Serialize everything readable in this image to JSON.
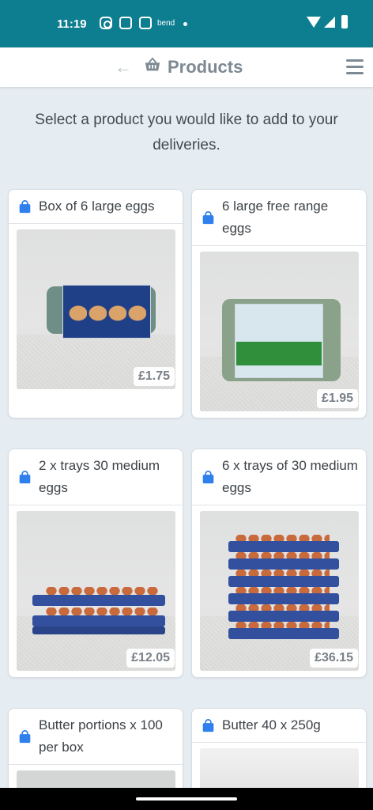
{
  "status_bar": {
    "time": "11:19",
    "notification_icons": [
      "instagram-icon",
      "outlook-icon",
      "outlook-icon"
    ],
    "notification_text": "bend",
    "system_icons": [
      "wifi-icon",
      "signal-icon",
      "battery-icon"
    ]
  },
  "app_bar": {
    "title": "Products",
    "icons": [
      "back-arrow-icon",
      "basket-icon",
      "hamburger-menu-icon"
    ]
  },
  "intro_text": "Select a product you would like to add to your deliveries.",
  "colors": {
    "status_bar": "#0c7e90",
    "background": "#e6edf2",
    "icon_accent": "#2f80ed"
  },
  "products": [
    {
      "name": "Box of 6 large eggs",
      "price": "£1.75",
      "image": "box of 6 large eggs"
    },
    {
      "name": "6 large free range eggs",
      "price": "£1.95",
      "image": "box of 6 free range eggs"
    },
    {
      "name": "2 x trays 30 medium eggs",
      "price": "£12.05",
      "image": "two egg trays"
    },
    {
      "name": "6 x trays of 30 medium eggs",
      "price": "£36.15",
      "image": "six egg trays"
    },
    {
      "name": "Butter portions x 100 per box",
      "price": "",
      "image": ""
    },
    {
      "name": "Butter 40 x 250g",
      "price": "",
      "image": ""
    }
  ]
}
